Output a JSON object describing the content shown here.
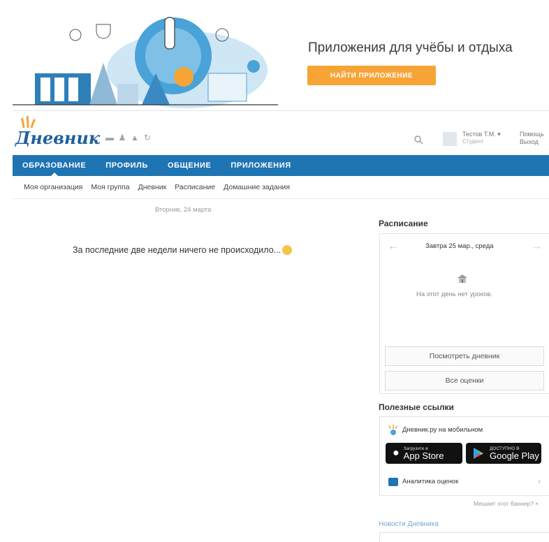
{
  "banner": {
    "title": "Приложения для учёбы и отдыха",
    "button_label": "НАЙТИ ПРИЛОЖЕНИЕ"
  },
  "header": {
    "logo": "Дневник",
    "user": {
      "name": "Тестов Т.М. ▾",
      "role": "Студент"
    },
    "help": "Помощь",
    "logout": "Выход"
  },
  "nav": {
    "items": [
      {
        "label": "ОБРАЗОВАНИЕ",
        "active": true
      },
      {
        "label": "ПРОФИЛЬ"
      },
      {
        "label": "ОБЩЕНИЕ"
      },
      {
        "label": "ПРИЛОЖЕНИЯ"
      }
    ]
  },
  "subnav": {
    "items": [
      "Моя организация",
      "Моя группа",
      "Дневник",
      "Расписание",
      "Домашние задания"
    ]
  },
  "main": {
    "date": "Вторник, 24 марта",
    "empty_message": "За последние две недели ничего не происходило..."
  },
  "schedule": {
    "title": "Расписание",
    "day": "Завтра 25 мар., среда",
    "empty": "На этот день нет уроков.",
    "view_diary": "Посмотреть дневник",
    "all_grades": "Все оценки"
  },
  "useful_links": {
    "title": "Полезные ссылки",
    "mobile_label": "Дневник.ру на мобильном",
    "appstore_small": "Загрузите в",
    "appstore_big": "App Store",
    "googleplay_small": "ДОСТУПНО В",
    "googleplay_big": "Google Play",
    "analytics_label": "Аналитика оценок"
  },
  "banner_question": "Мешает этот баннер? ×",
  "news_title": "Новости Дневника",
  "colors": {
    "brand_blue": "#1f74b3",
    "accent_orange": "#f7a436"
  }
}
